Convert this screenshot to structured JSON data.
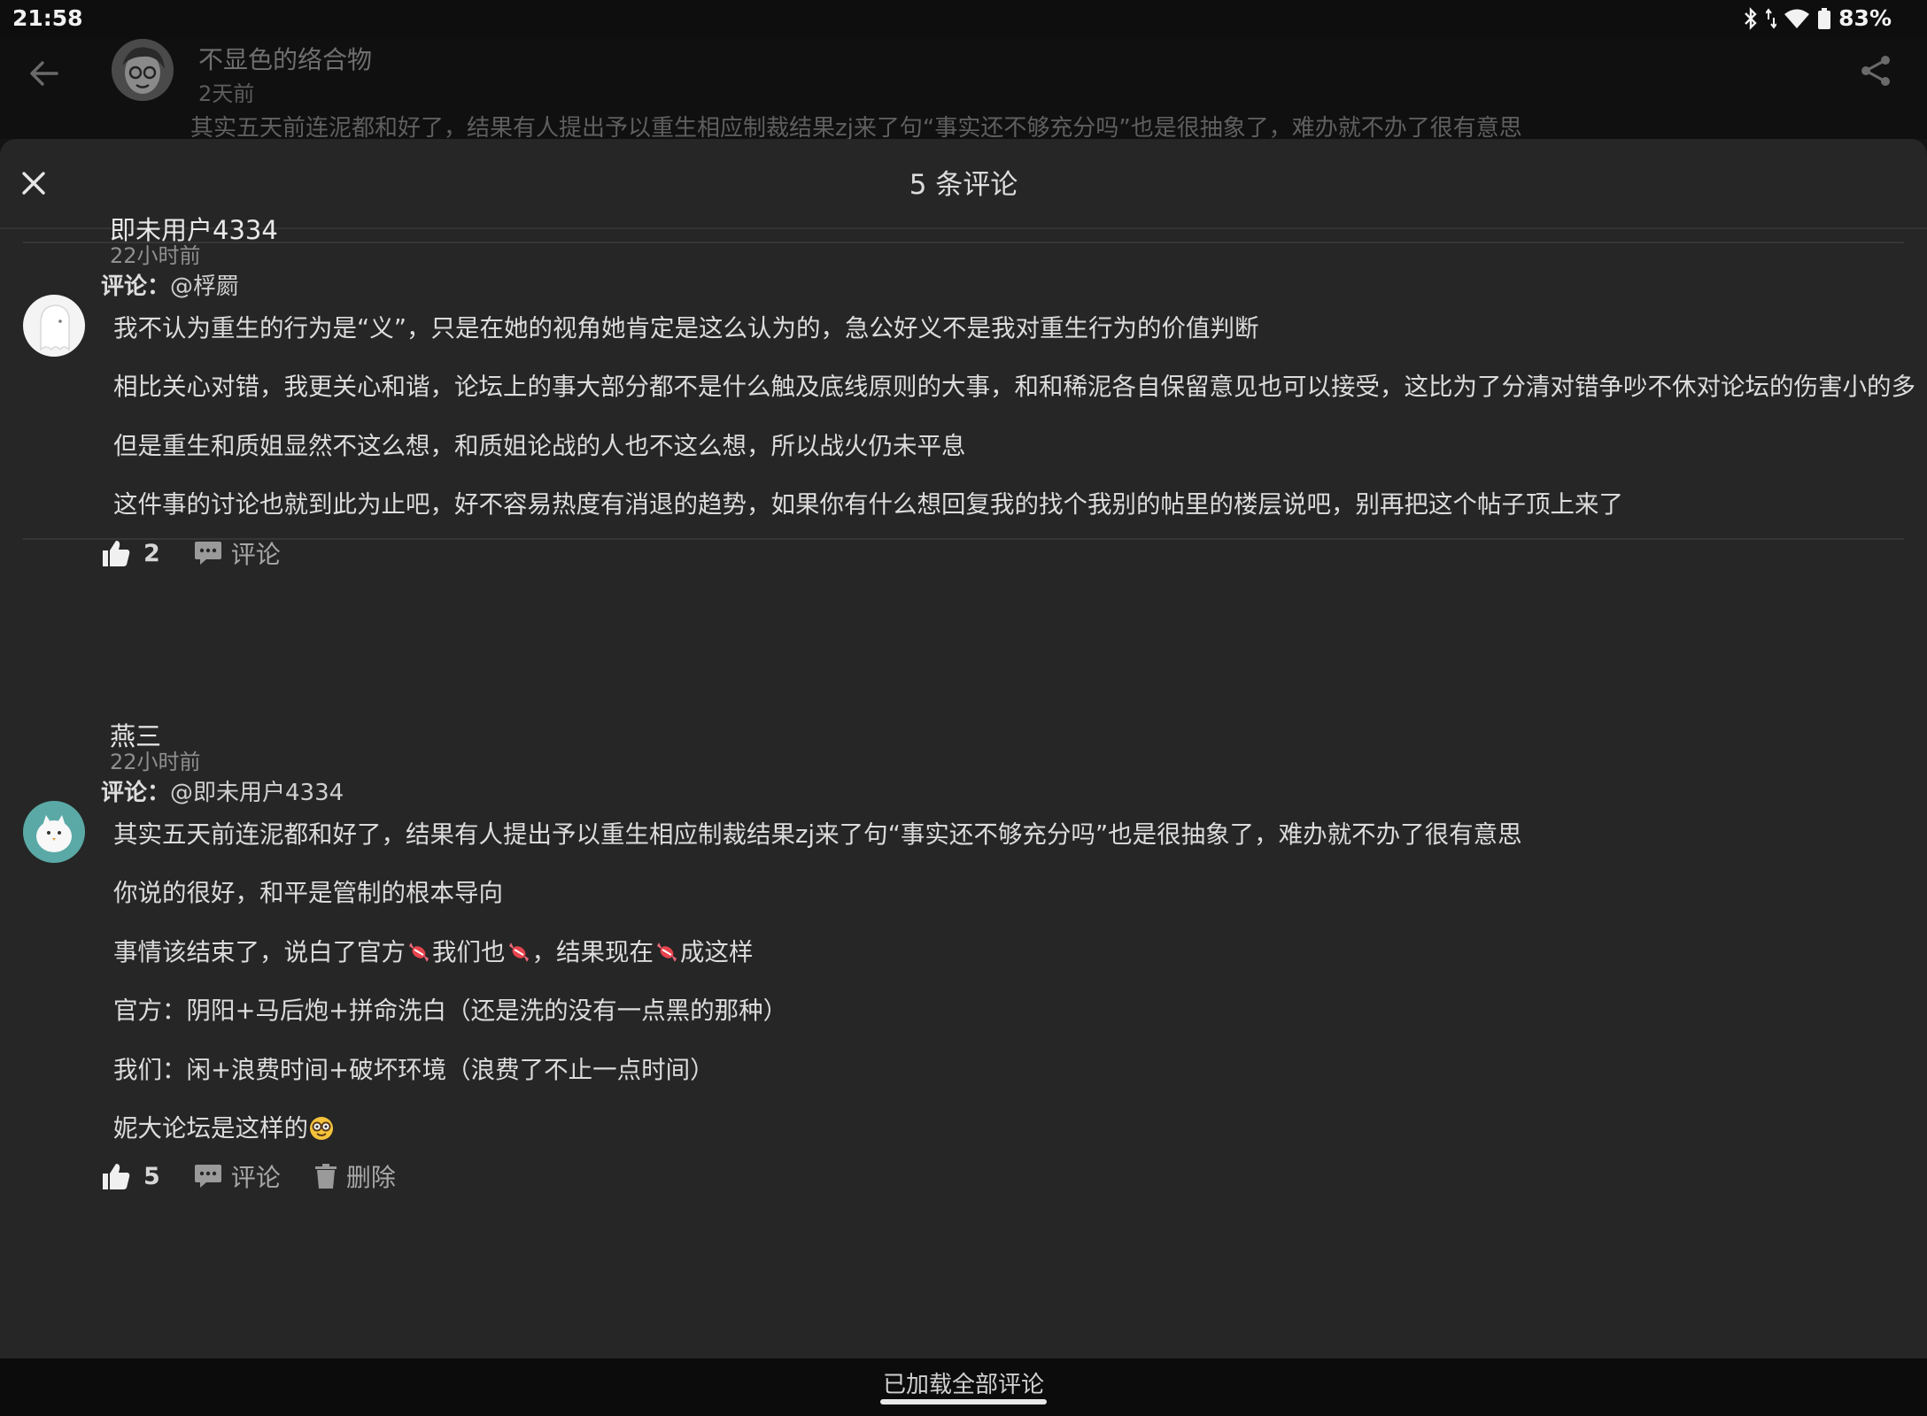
{
  "status_bar": {
    "time": "21:58",
    "battery": "83%"
  },
  "background_post": {
    "author": "不显色的络合物",
    "time": "2天前",
    "snippet": "其实五天前连泥都和好了，结果有人提出予以重生相应制裁结果zj来了句“事实还不够充分吗”也是很抽象了，难办就不办了很有意思"
  },
  "sheet": {
    "title": "5 条评论"
  },
  "comments": [
    {
      "author": "即未用户4334",
      "time": "22小时前",
      "reply_label": "评论：",
      "reply_target": "@桴罽",
      "lines": [
        "我不认为重生的行为是“义”，只是在她的视角她肯定是这么认为的，急公好义不是我对重生行为的价值判断",
        "相比关心对错，我更关心和谐，论坛上的事大部分都不是什么触及底线原则的大事，和和稀泥各自保留意见也可以接受，这比为了分清对错争吵不休对论坛的伤害小的多",
        "但是重生和质姐显然不这么想，和质姐论战的人也不这么想，所以战火仍未平息",
        "这件事的讨论也就到此为止吧，好不容易热度有消退的趋势，如果你有什么想回复我的找个我别的帖里的楼层说吧，别再把这个帖子顶上来了"
      ],
      "likes": "2",
      "comment_label": "评论"
    },
    {
      "author": "燕三",
      "time": "22小时前",
      "reply_label": "评论：",
      "reply_target": "@即未用户4334",
      "lines": [
        "其实五天前连泥都和好了，结果有人提出予以重生相应制裁结果zj来了句“事实还不够充分吗”也是很抽象了，难办就不办了很有意思",
        "你说的很好，和平是管制的根本导向"
      ],
      "line3": {
        "a": "事情该结束了，说白了官方",
        "b": "我们也",
        "c": "，结果现在",
        "d": "成这样"
      },
      "line4": "官方：阴阳+马后炮+拼命洗白（还是洗的没有一点黑的那种）",
      "line5": "我们：闲+浪费时间+破坏环境（浪费了不止一点时间）",
      "line6": "妮大论坛是这样的",
      "likes": "5",
      "comment_label": "评论",
      "delete_label": "删除"
    }
  ],
  "footer": {
    "text": "已加载全部评论"
  },
  "icons": {
    "back": "arrow-left-icon",
    "share": "share-icon",
    "close": "close-icon",
    "like": "thumbs-up-icon",
    "comment": "comment-bubble-icon",
    "delete": "trash-icon",
    "candy": "candy-emoji-icon",
    "nerd": "nerd-face-emoji-icon"
  }
}
